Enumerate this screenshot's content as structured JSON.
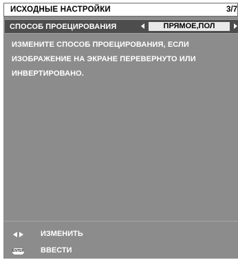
{
  "header": {
    "title": "ИСХОДНЫЕ НАСТРОЙКИ",
    "page": "3/7"
  },
  "menu_item": {
    "label": "СПОСОБ ПРОЕЦИРОВАНИЯ",
    "value": "ПРЯМОЕ,ПОЛ"
  },
  "description": {
    "lines": [
      "ИЗМЕНИТЕ СПОСОБ ПРОЕЦИРОВАНИЯ, ЕСЛИ",
      "ИЗОБРАЖЕНИЕ НА ЭКРАНЕ ПЕРЕВЕРНУТО ИЛИ",
      "ИНВЕРТИРОВАНО."
    ]
  },
  "footer": {
    "change_label": "ИЗМЕНИТЬ",
    "enter_label": "ВВЕСТИ",
    "enter_icon_text": "ENTER",
    "change_icon": "left-right-arrows-icon"
  },
  "colors": {
    "panel": "#8c8c8c",
    "selected_row": "#4d4d4d",
    "value_box": "#e9e9e9"
  }
}
